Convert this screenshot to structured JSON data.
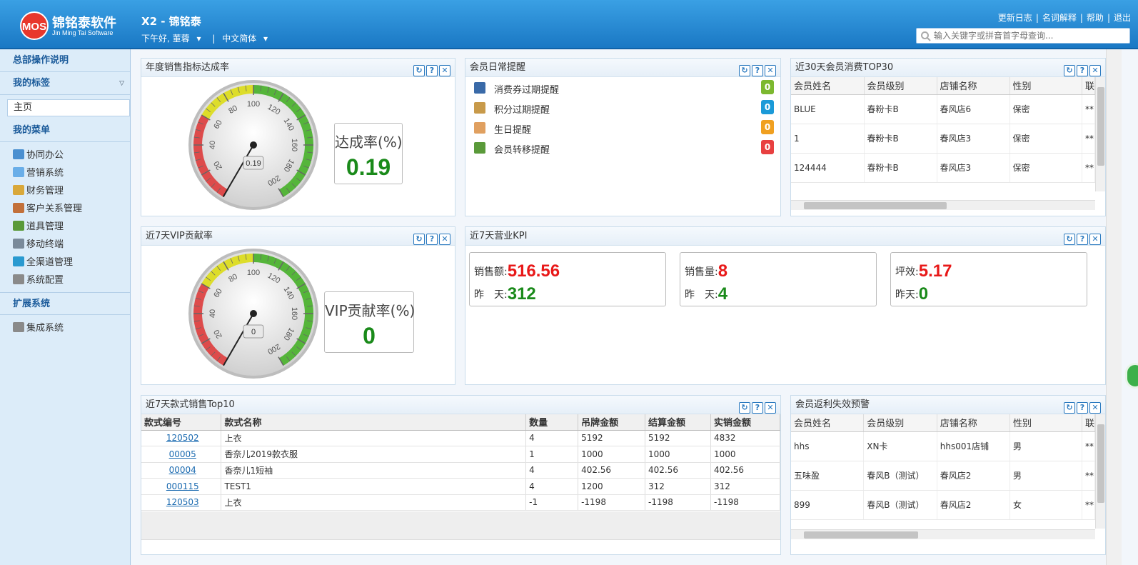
{
  "header": {
    "logo_mark": "MOS",
    "logo_cn": "锦铭泰软件",
    "logo_en": "Jin Ming Tai Software",
    "title": "X2 - 锦铭泰",
    "greeting": "下午好, 董蓉",
    "greeting_arrow": "▾",
    "lang": "中文简体",
    "links": [
      "更新日志",
      "名词解释",
      "帮助",
      "退出"
    ],
    "search_placeholder": "输入关键字或拼音首字母查询..."
  },
  "sidebar": {
    "sec_help": "总部操作说明",
    "sec_tags": "我的标签",
    "home": "主页",
    "sec_menu": "我的菜单",
    "menu": [
      {
        "label": "协同办公",
        "icon": "office-icon",
        "color": "#4a8fd0"
      },
      {
        "label": "营销系统",
        "icon": "cube-icon",
        "color": "#6aaee8"
      },
      {
        "label": "财务管理",
        "icon": "finance-icon",
        "color": "#d9a83a"
      },
      {
        "label": "客户关系管理",
        "icon": "users-icon",
        "color": "#c2703a"
      },
      {
        "label": "道具管理",
        "icon": "box-icon",
        "color": "#5a9a3a"
      },
      {
        "label": "移动终端",
        "icon": "mobile-icon",
        "color": "#7a8a9a"
      },
      {
        "label": "全渠道管理",
        "icon": "globe-icon",
        "color": "#2a9ad0"
      },
      {
        "label": "系统配置",
        "icon": "gear-icon",
        "color": "#8a8a8a"
      }
    ],
    "sec_ext": "扩展系统",
    "ext": [
      {
        "label": "集成系统",
        "icon": "gears-icon",
        "color": "#8a8a8a"
      }
    ]
  },
  "panels": {
    "annual": {
      "title": "年度销售指标达成率",
      "rate_label": "达成率(%)",
      "rate_value": "0.19",
      "gauge_value": 0.19,
      "gauge_readout": "0.19"
    },
    "member_remind": {
      "title": "会员日常提醒",
      "items": [
        {
          "label": "消费券过期提醒",
          "count": "0",
          "color": "#7cb82f",
          "icon": "coupon-icon",
          "icon_color": "#3a6aa8"
        },
        {
          "label": "积分过期提醒",
          "count": "0",
          "color": "#1b9ad8",
          "icon": "hourglass-icon",
          "icon_color": "#c89a4a"
        },
        {
          "label": "生日提醒",
          "count": "0",
          "color": "#f0a020",
          "icon": "cake-icon",
          "icon_color": "#e0a060"
        },
        {
          "label": "会员转移提醒",
          "count": "0",
          "color": "#e84040",
          "icon": "transfer-icon",
          "icon_color": "#5a9a3a"
        }
      ]
    },
    "top30": {
      "title": "近30天会员消费TOP30",
      "columns": [
        "会员姓名",
        "会员级别",
        "店铺名称",
        "性别",
        "联"
      ],
      "rows": [
        [
          "BLUE",
          "春粉卡B",
          "春风店6",
          "保密",
          "**"
        ],
        [
          "1",
          "春粉卡B",
          "春风店3",
          "保密",
          "**"
        ],
        [
          "124444",
          "春粉卡B",
          "春风店3",
          "保密",
          "**"
        ]
      ]
    },
    "vip": {
      "title": "近7天VIP贡献率",
      "rate_label": "VIP贡献率(%)",
      "rate_value": "0",
      "gauge_value": 0,
      "gauge_readout": "0"
    },
    "kpi": {
      "title": "近7天营业KPI",
      "boxes": [
        {
          "l1": "销售额:",
          "v1": "516.56",
          "l2": "昨　天:",
          "v2": "312"
        },
        {
          "l1": "销售量:",
          "v1": "8",
          "l2": "昨　天:",
          "v2": "4"
        },
        {
          "l1": "坪效:",
          "v1": "5.17",
          "l2": "昨天:",
          "v2": "0"
        }
      ]
    },
    "top10": {
      "title": "近7天款式销售Top10",
      "columns": [
        "款式编号",
        "款式名称",
        "数量",
        "吊牌金额",
        "结算金额",
        "实销金额"
      ],
      "rows": [
        [
          "120502",
          "上衣",
          "4",
          "5192",
          "5192",
          "4832"
        ],
        [
          "00005",
          "香奈儿2019款衣服",
          "1",
          "1000",
          "1000",
          "1000"
        ],
        [
          "00004",
          "香奈儿1短袖",
          "4",
          "402.56",
          "402.56",
          "402.56"
        ],
        [
          "000115",
          "TEST1",
          "4",
          "1200",
          "312",
          "312"
        ],
        [
          "120503",
          "上衣",
          "-1",
          "-1198",
          "-1198",
          "-1198"
        ]
      ]
    },
    "rebate": {
      "title": "会员返利失效预警",
      "columns": [
        "会员姓名",
        "会员级别",
        "店铺名称",
        "性别",
        "联"
      ],
      "rows": [
        [
          "hhs",
          "XN卡",
          "hhs001店铺",
          "男",
          "**"
        ],
        [
          "五味盈",
          "春风B（测试）",
          "春风店2",
          "男",
          "**"
        ],
        [
          "899",
          "春风B（测试）",
          "春风店2",
          "女",
          "**"
        ]
      ]
    }
  },
  "gauge_ticks": [
    "20",
    "40",
    "60",
    "80",
    "100",
    "120",
    "140",
    "160",
    "180",
    "200"
  ],
  "tool_labels": {
    "refresh": "↻",
    "help": "?",
    "close": "✕"
  }
}
